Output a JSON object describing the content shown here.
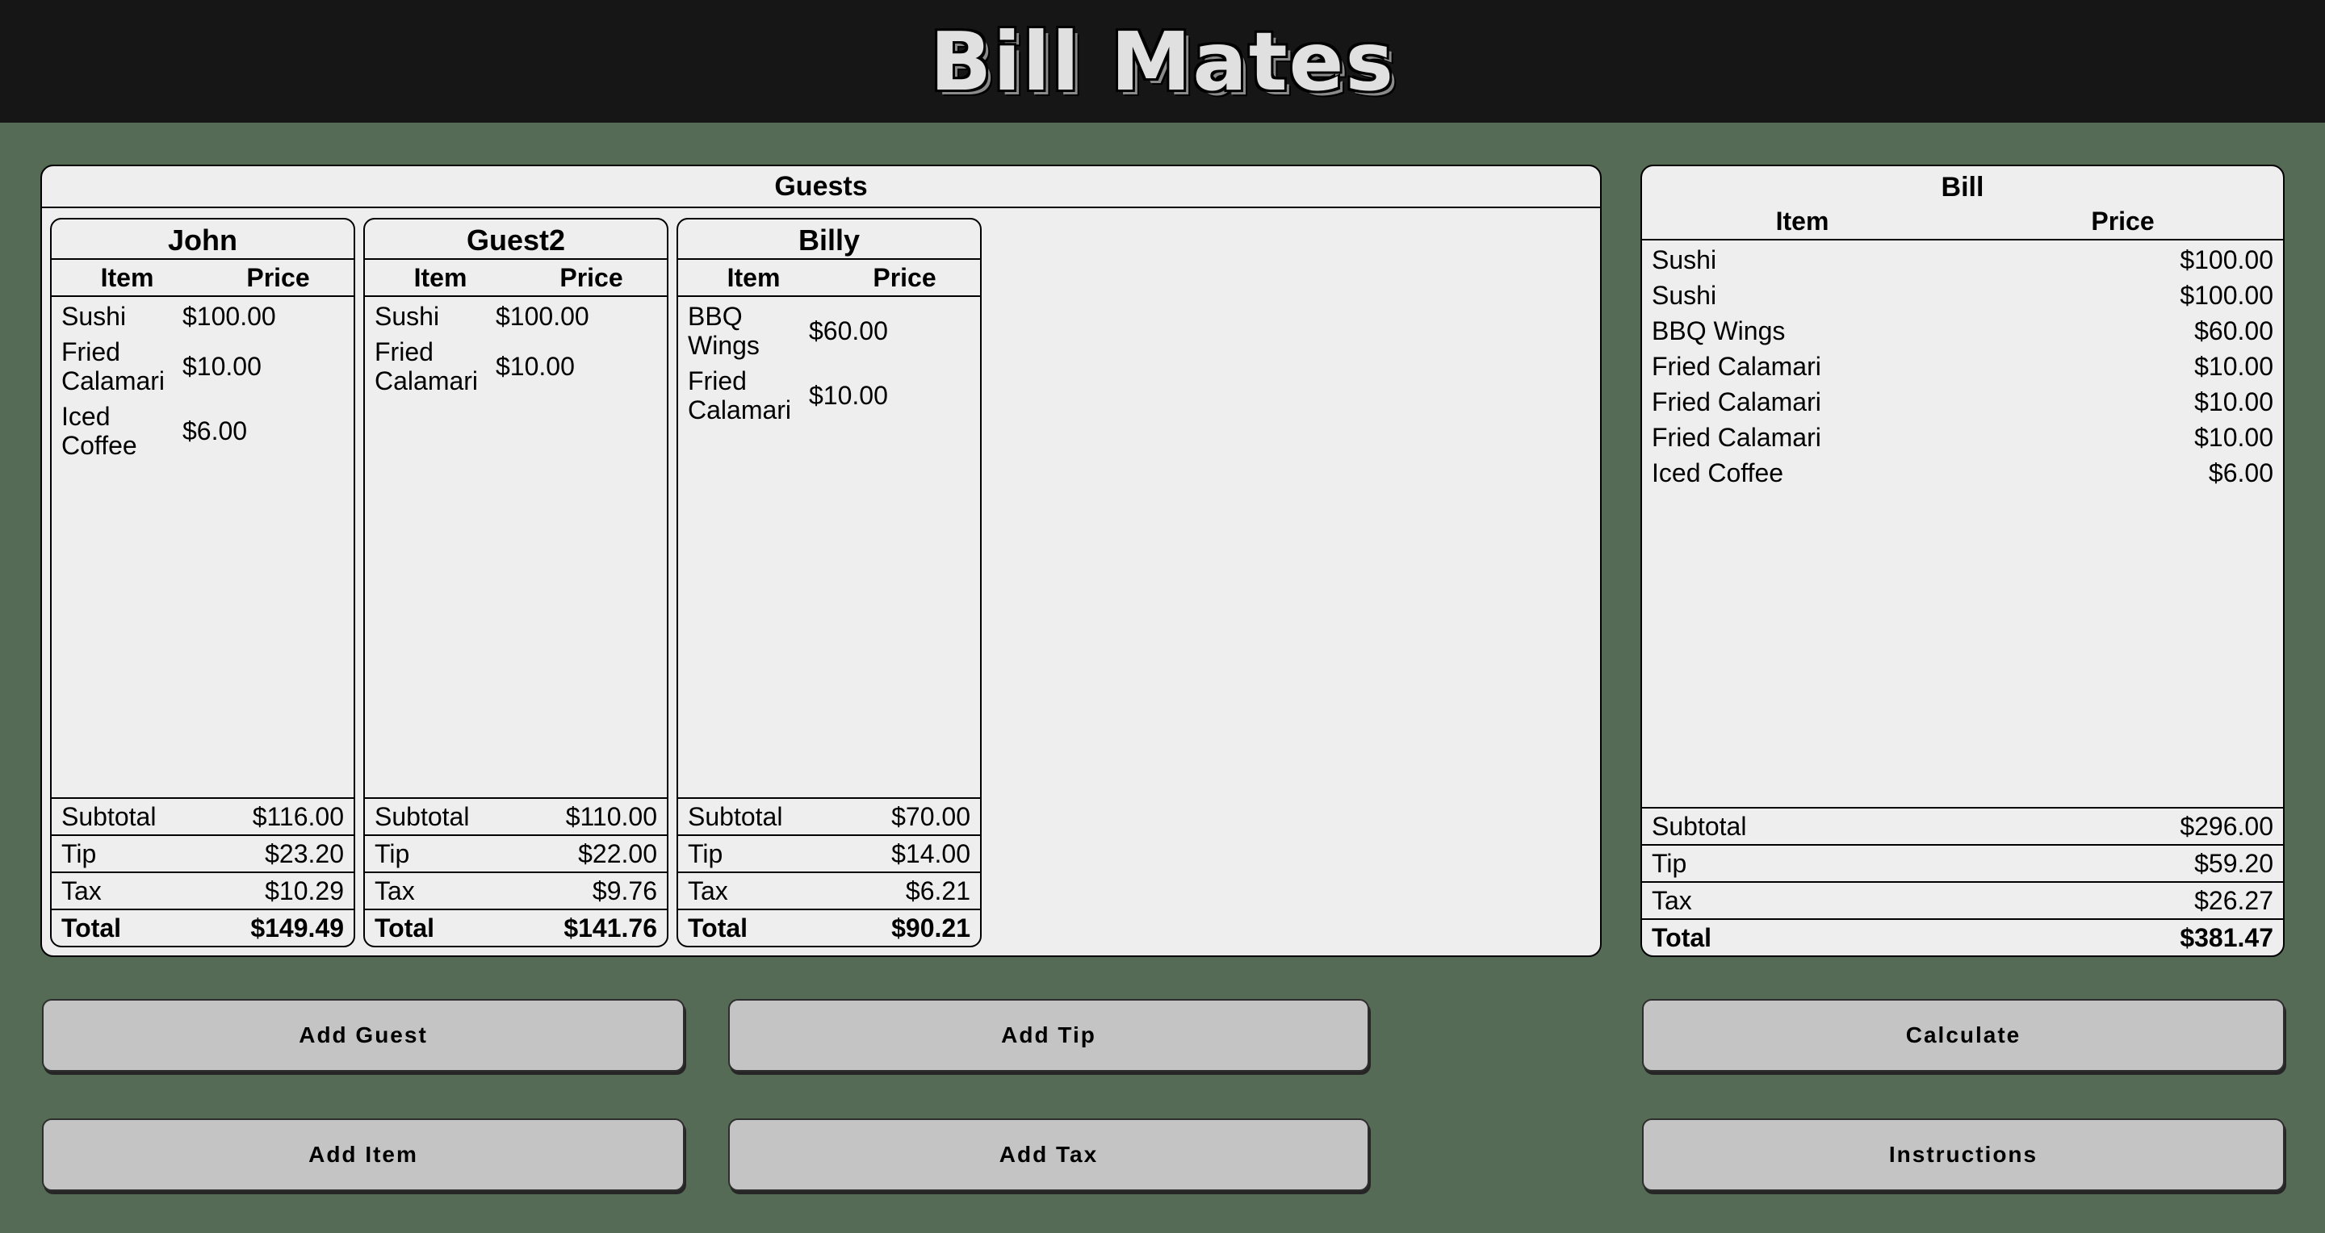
{
  "app": {
    "title": "Bill Mates"
  },
  "guests_panel": {
    "title": "Guests",
    "guests": [
      {
        "name": "John",
        "headers": {
          "item": "Item",
          "price": "Price"
        },
        "items": [
          {
            "name": "Sushi",
            "price": "$100.00"
          },
          {
            "name": "Fried Calamari",
            "price": "$10.00"
          },
          {
            "name": "Iced Coffee",
            "price": "$6.00"
          }
        ],
        "subtotal": {
          "label": "Subtotal",
          "value": "$116.00"
        },
        "tip": {
          "label": "Tip",
          "value": "$23.20"
        },
        "tax": {
          "label": "Tax",
          "value": "$10.29"
        },
        "total": {
          "label": "Total",
          "value": "$149.49"
        }
      },
      {
        "name": "Guest2",
        "headers": {
          "item": "Item",
          "price": "Price"
        },
        "items": [
          {
            "name": "Sushi",
            "price": "$100.00"
          },
          {
            "name": "Fried Calamari",
            "price": "$10.00"
          }
        ],
        "subtotal": {
          "label": "Subtotal",
          "value": "$110.00"
        },
        "tip": {
          "label": "Tip",
          "value": "$22.00"
        },
        "tax": {
          "label": "Tax",
          "value": "$9.76"
        },
        "total": {
          "label": "Total",
          "value": "$141.76"
        }
      },
      {
        "name": "Billy",
        "headers": {
          "item": "Item",
          "price": "Price"
        },
        "items": [
          {
            "name": "BBQ Wings",
            "price": "$60.00"
          },
          {
            "name": "Fried Calamari",
            "price": "$10.00"
          }
        ],
        "subtotal": {
          "label": "Subtotal",
          "value": "$70.00"
        },
        "tip": {
          "label": "Tip",
          "value": "$14.00"
        },
        "tax": {
          "label": "Tax",
          "value": "$6.21"
        },
        "total": {
          "label": "Total",
          "value": "$90.21"
        }
      }
    ]
  },
  "bill": {
    "title": "Bill",
    "headers": {
      "item": "Item",
      "price": "Price"
    },
    "items": [
      {
        "name": "Sushi",
        "price": "$100.00"
      },
      {
        "name": "Sushi",
        "price": "$100.00"
      },
      {
        "name": "BBQ Wings",
        "price": "$60.00"
      },
      {
        "name": "Fried Calamari",
        "price": "$10.00"
      },
      {
        "name": "Fried Calamari",
        "price": "$10.00"
      },
      {
        "name": "Fried Calamari",
        "price": "$10.00"
      },
      {
        "name": "Iced Coffee",
        "price": "$6.00"
      }
    ],
    "subtotal": {
      "label": "Subtotal",
      "value": "$296.00"
    },
    "tip": {
      "label": "Tip",
      "value": "$59.20"
    },
    "tax": {
      "label": "Tax",
      "value": "$26.27"
    },
    "total": {
      "label": "Total",
      "value": "$381.47"
    }
  },
  "buttons": {
    "add_guest": "Add Guest",
    "add_tip": "Add Tip",
    "calculate": "Calculate",
    "add_item": "Add Item",
    "add_tax": "Add Tax",
    "instructions": "Instructions"
  },
  "colors": {
    "background": "#556b55",
    "header": "#161616",
    "panel": "#eeeeee",
    "button": "#c4c4c4"
  }
}
